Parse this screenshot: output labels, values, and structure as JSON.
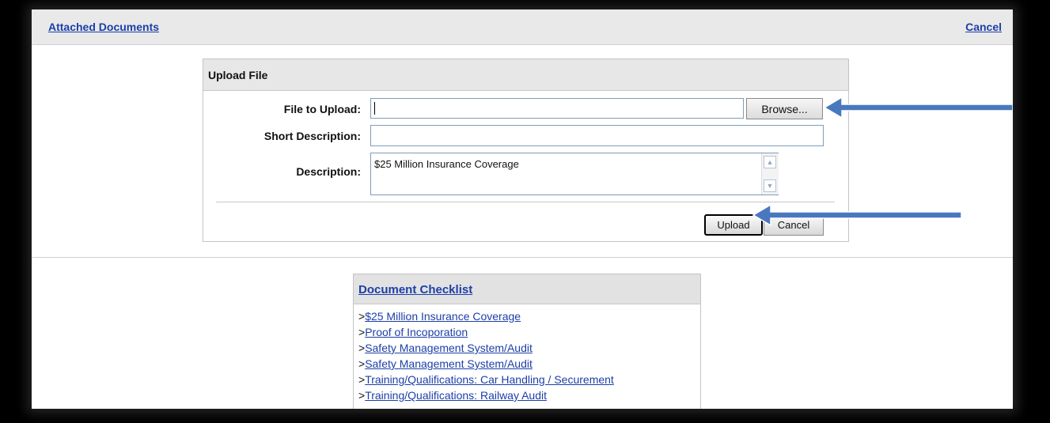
{
  "header": {
    "title_link": "Attached Documents",
    "cancel_link": "Cancel"
  },
  "upload": {
    "title": "Upload File",
    "file_label": "File to Upload:",
    "file_value": "",
    "browse_label": "Browse...",
    "short_desc_label": "Short Description:",
    "short_desc_value": "",
    "desc_label": "Description:",
    "desc_value": "$25 Million Insurance Coverage",
    "upload_label": "Upload",
    "cancel_label": "Cancel"
  },
  "checklist": {
    "title": "Document Checklist",
    "items": [
      {
        "prefix": ">",
        "label": "$25 Million Insurance Coverage"
      },
      {
        "prefix": ">",
        "label": "Proof of Incoporation"
      },
      {
        "prefix": ">",
        "label": "Safety Management System/Audit"
      },
      {
        "prefix": ">",
        "label": "Safety Management System/Audit"
      },
      {
        "prefix": ">",
        "label": "Training/Qualifications: Car Handling / Securement"
      },
      {
        "prefix": ">",
        "label": "Training/Qualifications: Railway Audit"
      }
    ]
  },
  "icons": {
    "scroll_up": "scroll-up-icon",
    "scroll_down": "scroll-down-icon",
    "arrow": "annotation-arrow-icon"
  },
  "colors": {
    "link": "#1c3fa8",
    "panel_header": "#e7e7e7",
    "arrow": "#4a78bf"
  }
}
